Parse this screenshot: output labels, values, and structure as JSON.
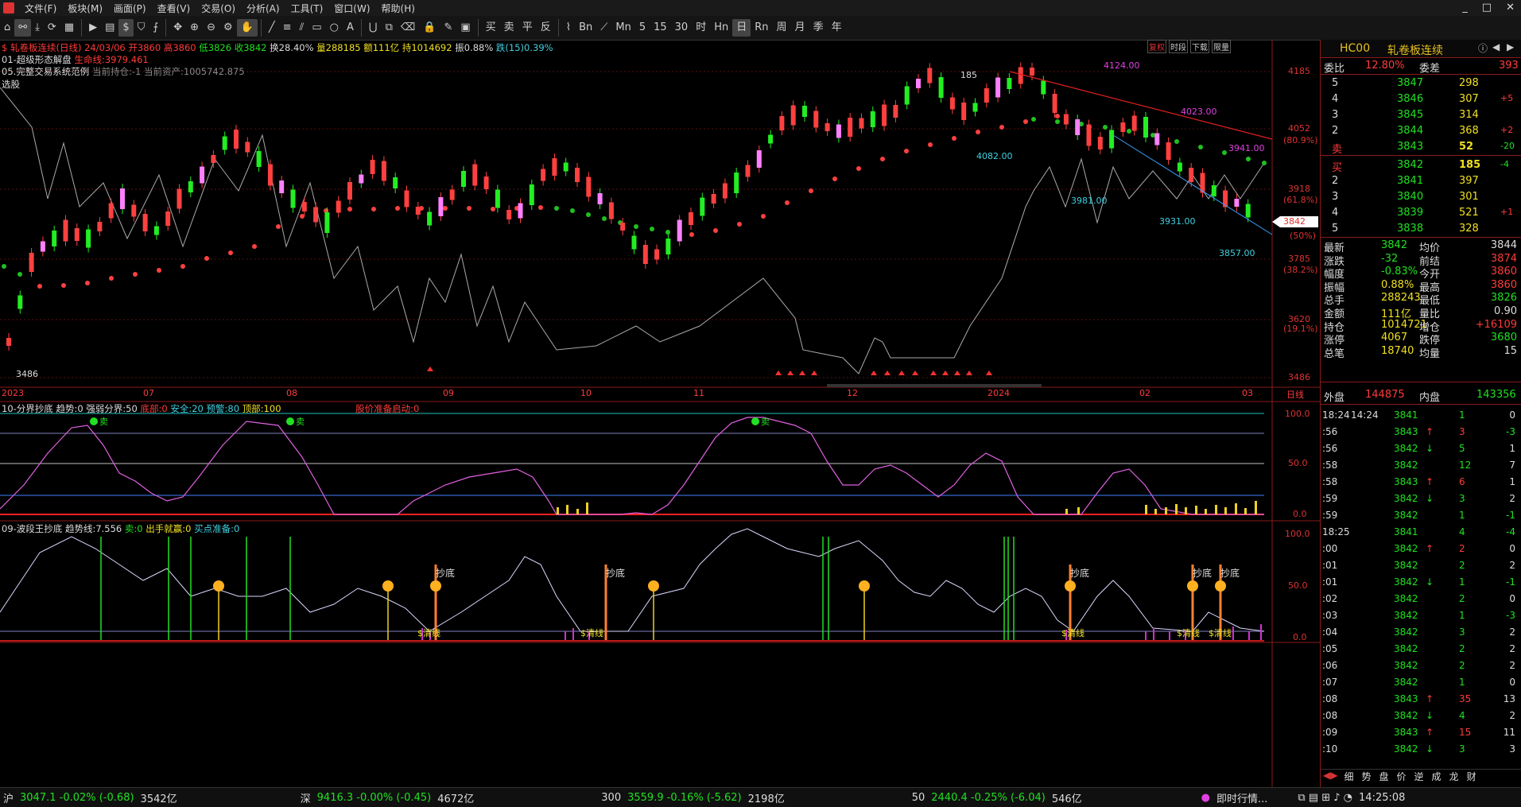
{
  "menu": [
    "文件(F)",
    "板块(M)",
    "画面(P)",
    "查看(V)",
    "交易(O)",
    "分析(A)",
    "工具(T)",
    "窗口(W)",
    "帮助(H)"
  ],
  "toolbar_right": [
    "买",
    "卖",
    "平",
    "反",
    "Bn",
    "Mn",
    "5",
    "15",
    "30",
    "时",
    "Hn",
    "日",
    "Rn",
    "周",
    "月",
    "季",
    "年"
  ],
  "window_controls": [
    "_",
    "□",
    "✕"
  ],
  "chart": {
    "symbol_line": "$ 轧卷板连续(日线) 24/03/06",
    "open": "开3860",
    "high": "高3860",
    "low": "低3826",
    "close": "收3842",
    "turnover": "换28.40%",
    "volume": "量288185",
    "amount": "额111亿",
    "oi": "持1014692",
    "amplitude": "振0.88%",
    "fall": "跌(15)0.39%",
    "indicator1": "01-超级形态解盘",
    "life_line": "生命线:3979.461",
    "indicator2": "05.完整交易系统范例",
    "position": "当前持仓:-1",
    "asset": "当前资产:1005742.875",
    "select_label": "选股",
    "price_axis": [
      "4185",
      "4052",
      "3918",
      "3785",
      "3620",
      "3486"
    ],
    "pct_axis": [
      "(80.9%)",
      "(61.8%)",
      "(50%)",
      "(38.2%)",
      "(19.1%)"
    ],
    "price_notes": [
      "4124.00",
      "4023.00",
      "3941.00",
      "4082.00",
      "3981.00",
      "3931.00",
      "3857.00",
      "3486",
      "185"
    ],
    "last_price_tag": "3842",
    "date_axis": [
      "2023",
      "07",
      "08",
      "09",
      "10",
      "11",
      "12",
      "2024",
      "02",
      "03",
      "日线"
    ],
    "top_buttons": [
      "复权",
      "时段",
      "下载",
      "限量"
    ],
    "sub1_title": "10-分界抄底",
    "sub1_trend": "趋势:0",
    "sub1_strong": "强弱分界:50",
    "sub1_bottom": "底部:0",
    "sub1_safe": "安全:20",
    "sub1_warn": "预警:80",
    "sub1_top": "顶部:100",
    "sub1_alert": "股价准备启动:0",
    "sub1_axis": [
      "100.0",
      "50.0",
      "0.0"
    ],
    "sub1_sell": "卖",
    "sub2_title": "09-波段王抄底",
    "sub2_trend": "趋势线:7.556",
    "sub2_sell": "卖:0",
    "sub2_act": "出手就赢:0",
    "sub2_buy": "买点准备:0",
    "sub2_axis": [
      "100.0",
      "50.0",
      "0.0"
    ],
    "sub2_bottom": "抄底",
    "sub2_money": "$清线"
  },
  "sidebar": {
    "code": "HC00",
    "name": "轧卷板连续",
    "weibi_label": "委比",
    "weibi": "12.80%",
    "weicha_label": "委差",
    "weicha": "393",
    "asks": [
      {
        "lvl": "5",
        "price": "3847",
        "vol": "298",
        "chg": ""
      },
      {
        "lvl": "4",
        "price": "3846",
        "vol": "307",
        "chg": "+5"
      },
      {
        "lvl": "3",
        "price": "3845",
        "vol": "314",
        "chg": ""
      },
      {
        "lvl": "2",
        "price": "3844",
        "vol": "368",
        "chg": "+2"
      },
      {
        "lvl": "卖",
        "price": "3843",
        "vol": "52",
        "chg": "-20"
      }
    ],
    "bids": [
      {
        "lvl": "买",
        "price": "3842",
        "vol": "185",
        "chg": "-4"
      },
      {
        "lvl": "2",
        "price": "3841",
        "vol": "397",
        "chg": ""
      },
      {
        "lvl": "3",
        "price": "3840",
        "vol": "301",
        "chg": ""
      },
      {
        "lvl": "4",
        "price": "3839",
        "vol": "521",
        "chg": "+1"
      },
      {
        "lvl": "5",
        "price": "3838",
        "vol": "328",
        "chg": ""
      }
    ],
    "quotes": [
      {
        "l1": "最新",
        "v1": "3842",
        "l2": "均价",
        "v2": "3844"
      },
      {
        "l1": "涨跌",
        "v1": "-32",
        "l2": "前结",
        "v2": "3874"
      },
      {
        "l1": "幅度",
        "v1": "-0.83%",
        "l2": "今开",
        "v2": "3860"
      },
      {
        "l1": "振幅",
        "v1": "0.88%",
        "l2": "最高",
        "v2": "3860"
      },
      {
        "l1": "总手",
        "v1": "288243",
        "l2": "最低",
        "v2": "3826"
      },
      {
        "l1": "金额",
        "v1": "111亿",
        "l2": "量比",
        "v2": "0.90"
      },
      {
        "l1": "持仓",
        "v1": "1014721",
        "l2": "增仓",
        "v2": "+16109"
      },
      {
        "l1": "涨停",
        "v1": "4067",
        "l2": "跌停",
        "v2": "3680"
      },
      {
        "l1": "总笔",
        "v1": "18740",
        "l2": "均量",
        "v2": "15"
      }
    ],
    "outer_label": "外盘",
    "outer": "144875",
    "inner_label": "内盘",
    "inner": "143356",
    "ticks": [
      {
        "t": "18:24",
        "p": "14:24",
        "v": "3841",
        "a": "",
        "n": "1",
        "d": "0"
      },
      {
        "t": ":56",
        "p": "",
        "v": "3843",
        "a": "↑",
        "n": "3",
        "d": "-3"
      },
      {
        "t": ":56",
        "p": "",
        "v": "3842",
        "a": "↓",
        "n": "5",
        "d": "1"
      },
      {
        "t": ":58",
        "p": "",
        "v": "3842",
        "a": "",
        "n": "12",
        "d": "7"
      },
      {
        "t": ":58",
        "p": "",
        "v": "3843",
        "a": "↑",
        "n": "6",
        "d": "1"
      },
      {
        "t": ":59",
        "p": "",
        "v": "3842",
        "a": "↓",
        "n": "3",
        "d": "2"
      },
      {
        "t": ":59",
        "p": "",
        "v": "3842",
        "a": "",
        "n": "1",
        "d": "-1"
      },
      {
        "t": "18:25",
        "p": "",
        "v": "3841",
        "a": "",
        "n": "4",
        "d": "-4"
      },
      {
        "t": ":00",
        "p": "",
        "v": "3842",
        "a": "↑",
        "n": "2",
        "d": "0"
      },
      {
        "t": ":01",
        "p": "",
        "v": "3842",
        "a": "",
        "n": "2",
        "d": "2"
      },
      {
        "t": ":01",
        "p": "",
        "v": "3842",
        "a": "↓",
        "n": "1",
        "d": "-1"
      },
      {
        "t": ":02",
        "p": "",
        "v": "3842",
        "a": "",
        "n": "2",
        "d": "0"
      },
      {
        "t": ":03",
        "p": "",
        "v": "3842",
        "a": "",
        "n": "1",
        "d": "-3"
      },
      {
        "t": ":04",
        "p": "",
        "v": "3842",
        "a": "",
        "n": "3",
        "d": "2"
      },
      {
        "t": ":05",
        "p": "",
        "v": "3842",
        "a": "",
        "n": "2",
        "d": "2"
      },
      {
        "t": ":06",
        "p": "",
        "v": "3842",
        "a": "",
        "n": "2",
        "d": "2"
      },
      {
        "t": ":07",
        "p": "",
        "v": "3842",
        "a": "",
        "n": "1",
        "d": "0"
      },
      {
        "t": ":08",
        "p": "",
        "v": "3843",
        "a": "↑",
        "n": "35",
        "d": "13"
      },
      {
        "t": ":08",
        "p": "",
        "v": "3842",
        "a": "↓",
        "n": "4",
        "d": "2"
      },
      {
        "t": ":09",
        "p": "",
        "v": "3843",
        "a": "↑",
        "n": "15",
        "d": "11"
      },
      {
        "t": ":10",
        "p": "",
        "v": "3842",
        "a": "↓",
        "n": "3",
        "d": "3"
      }
    ],
    "tabs": [
      "细",
      "势",
      "盘",
      "价",
      "逆",
      "成",
      "龙",
      "财"
    ]
  },
  "statusbar": {
    "sh_label": "沪",
    "sh": "3047.1 -0.02% (-0.68)",
    "sh_amt": "3542亿",
    "sz_label": "深",
    "sz": "9416.3 -0.00% (-0.45)",
    "sz_amt": "4672亿",
    "i300_label": "300",
    "i300": "3559.9 -0.16% (-5.62)",
    "i300_amt": "2198亿",
    "i50_label": "50",
    "i50": "2440.4 -0.25% (-6.04)",
    "i50_amt": "546亿",
    "realtime": "即时行情...",
    "time": "14:25:08"
  },
  "colors": {
    "up": "#ff3b3b",
    "down": "#21e021",
    "grid": "#5a1010"
  }
}
